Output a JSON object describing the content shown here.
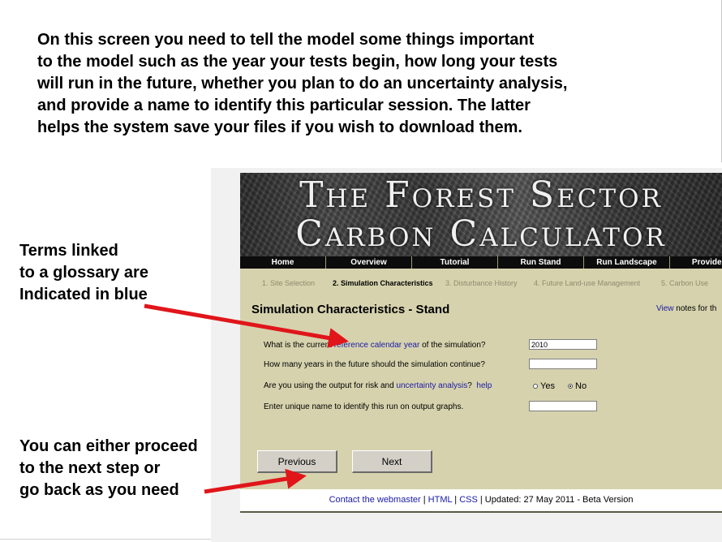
{
  "intro_lines": [
    "On this screen you need to tell the model some things important",
    "to the model such as the year your tests begin, how long your tests",
    "will run in the future, whether you plan to do an uncertainty analysis,",
    "and provide a name to identify this particular session.  The latter",
    "helps the system save your files if you wish to download them."
  ],
  "note_glossary": [
    "Terms linked",
    "to a glossary are",
    "Indicated in blue"
  ],
  "note_navigation": [
    "You can either proceed",
    "to the next step or",
    "go back as you need"
  ],
  "app": {
    "banner_lines": [
      "The Forest Sector",
      "Carbon Calculator"
    ],
    "nav": [
      "Home",
      "Overview",
      "Tutorial",
      "Run Stand",
      "Run Landscape",
      "Provide Fe"
    ],
    "steps": [
      "1. Site Selection",
      "2. Simulation Characteristics",
      "3. Disturbance History",
      "4. Future Land-use Management",
      "5. Carbon Use"
    ],
    "form_title": "Simulation Characteristics - Stand",
    "view_link": "View",
    "view_text": " notes for th",
    "q1_pre": "What is the current ",
    "q1_link": "reference calendar year",
    "q1_post": " of the simulation?",
    "q1_value": "2010",
    "q2": "How many years in the future should the simulation continue?",
    "q3_pre": "Are you using the output for risk and ",
    "q3_link": "uncertainty analysis",
    "q3_post": "?",
    "q3_help": "help",
    "radio_yes": "Yes",
    "radio_no": "No",
    "q4": "Enter unique name to identify this run on output graphs.",
    "btn_previous": "Previous",
    "btn_next": "Next",
    "footer_contact": "Contact the webmaster",
    "footer_sep1": " | ",
    "footer_html": "HTML",
    "footer_sep2": " | ",
    "footer_css": "CSS",
    "footer_updated": " | Updated: 27 May 2011 - Beta Version"
  },
  "colors": {
    "arrow": "#e0161a",
    "link": "#1a1aa6",
    "form_bg": "#d6d2ad"
  }
}
